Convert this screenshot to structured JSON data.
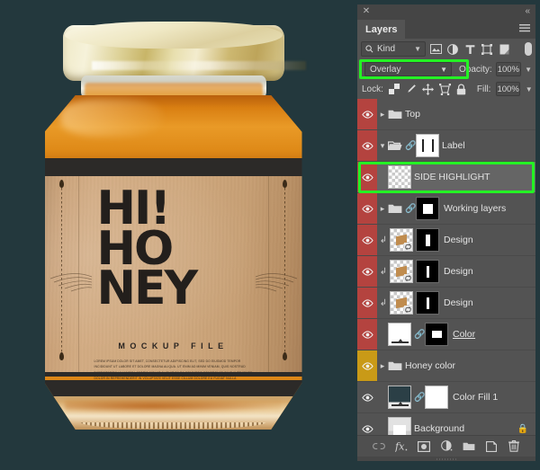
{
  "canvas": {
    "background_color": "#23383d",
    "artwork": {
      "name": "honey-jar-mockup",
      "brand_line1": "HI!",
      "brand_line2": "HO",
      "brand_line3": "NEY",
      "subtitle": "MOCKUP FILE",
      "body_copy": "LOREM IPSUM DOLOR SIT AMET, CONSECTETUR ADIPISCING ELIT, SED DO EIUSMOD TEMPOR INCIDIDUNT UT LABORE ET DOLORE MAGNA ALIQUA. UT ENIM AD MINIM VENIAM, QUIS NOSTRUD EXERCITATION ULLAMCO LABORIS NISI UT ALIQUIP EX EA COMMODO CONSEQUAT. DUIS AUTE IRURE DOLOR IN REPREHENDERIT IN VOLUPTATE VELIT ESSE CILLUM DOLORE EU FUGIAT NULLA PARIATUR. EXCEPTEUR SINT OCCAECAT CUPIDATAT NON PROIDENT, SUNT IN CULPA QUI OFFICIA DESERUNT MOLLIT ANIM ID EST LABORUM."
    }
  },
  "panel": {
    "close_label": "✕",
    "collapse_label": "«",
    "tab_label": "Layers",
    "menu_name": "panel-menu-icon",
    "filter": {
      "kind_label": "Kind",
      "icons": [
        "pixel-layer-filter-icon",
        "adjustment-layer-filter-icon",
        "type-layer-filter-icon",
        "shape-layer-filter-icon",
        "smart-object-filter-icon"
      ],
      "toggle_name": "filter-enable-toggle"
    },
    "blend": {
      "mode": "Overlay",
      "opacity_label": "Opacity:",
      "opacity_value": "100%",
      "highlight_color": "#24f224"
    },
    "lock": {
      "label": "Lock:",
      "icons": [
        "lock-transparent-pixels-icon",
        "lock-image-pixels-icon",
        "lock-position-icon",
        "lock-artboard-nesting-icon",
        "lock-all-icon"
      ],
      "fill_label": "Fill:",
      "fill_value": "100%"
    },
    "layers": [
      {
        "name": "Top",
        "visible": true,
        "eye_color": "red",
        "type": "group",
        "expanded": false,
        "selected": false,
        "highlighted": false
      },
      {
        "name": "Label",
        "visible": true,
        "eye_color": "red",
        "type": "group",
        "expanded": true,
        "linked": true,
        "has_mask": true,
        "selected": false,
        "highlighted": false
      },
      {
        "name": "SIDE HIGHLIGHT",
        "visible": true,
        "eye_color": "red",
        "type": "pixel",
        "selected": true,
        "highlighted": true
      },
      {
        "name": "Working layers",
        "visible": true,
        "eye_color": "red",
        "type": "group",
        "expanded": false,
        "linked": true,
        "has_mask": true,
        "selected": false,
        "highlighted": false
      },
      {
        "name": "Design",
        "visible": true,
        "eye_color": "red",
        "type": "smart-object",
        "clipped": true,
        "has_mask": true,
        "selected": false,
        "highlighted": false
      },
      {
        "name": "Design",
        "visible": true,
        "eye_color": "red",
        "type": "smart-object",
        "clipped": true,
        "has_mask": true,
        "selected": false,
        "highlighted": false
      },
      {
        "name": "Design",
        "visible": true,
        "eye_color": "red",
        "type": "smart-object",
        "clipped": true,
        "has_mask": true,
        "selected": false,
        "highlighted": false
      },
      {
        "name": "Color",
        "visible": true,
        "eye_color": "red",
        "type": "fill",
        "underlined": true,
        "linked": true,
        "has_mask": true,
        "selected": false,
        "highlighted": false
      },
      {
        "name": "Honey color",
        "visible": true,
        "eye_color": "yellow",
        "type": "group",
        "expanded": false,
        "selected": false,
        "highlighted": false
      },
      {
        "name": "Color Fill 1",
        "visible": true,
        "eye_color": "plain",
        "type": "fill",
        "linked": true,
        "has_mask": true,
        "selected": false,
        "highlighted": false
      },
      {
        "name": "Background",
        "visible": true,
        "eye_color": "plain",
        "type": "background",
        "locked": true,
        "selected": false,
        "highlighted": false
      }
    ],
    "footer_icons": [
      "link-layers-icon",
      "add-layer-style-icon",
      "add-layer-mask-icon",
      "new-fill-adjustment-icon",
      "new-group-icon",
      "new-layer-icon",
      "delete-layer-icon"
    ]
  }
}
